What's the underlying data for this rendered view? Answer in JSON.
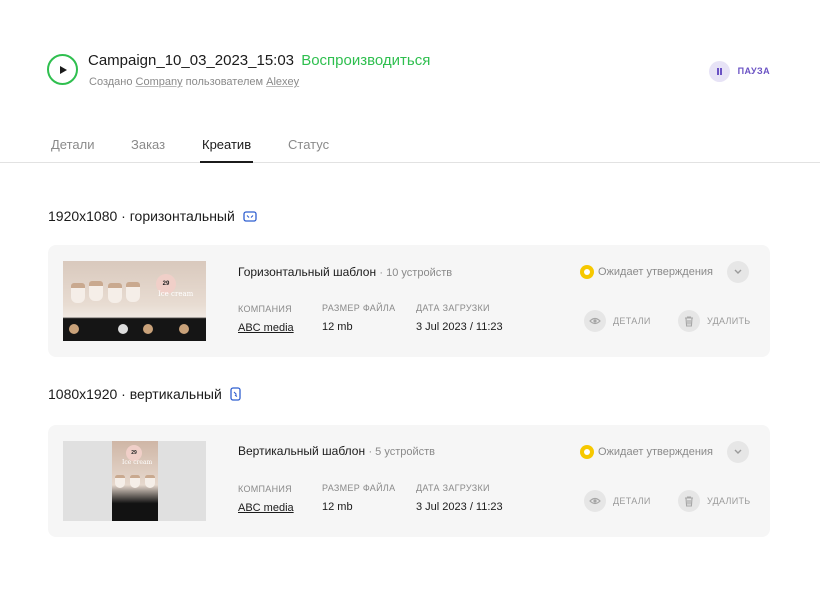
{
  "campaign": {
    "name": "Campaign_10_03_2023_15:03",
    "status": "Воспроизводиться",
    "created_prefix": "Создано",
    "company": "Company",
    "by_text": "пользователем",
    "user": "Alexey",
    "pause_label": "ПАУЗА"
  },
  "tabs": [
    {
      "label": "Детали",
      "active": false
    },
    {
      "label": "Заказ",
      "active": false
    },
    {
      "label": "Креатив",
      "active": true
    },
    {
      "label": "Статус",
      "active": false
    }
  ],
  "sections": [
    {
      "title": "1920x1080 · горизонтальный",
      "icon": "horizontal-screen-icon",
      "card": {
        "name": "Горизонтальный шаблон",
        "devices": "· 10 устройств",
        "status": "Ожидает утверждения",
        "company_label": "КОМПАНИЯ",
        "company_value": "ABC media",
        "size_label": "РАЗМЕР ФАЙЛА",
        "size_value": "12 mb",
        "date_label": "ДАТА ЗАГРУЗКИ",
        "date_value": "3 Jul 2023 / 11:23",
        "details_label": "ДЕТАЛИ",
        "delete_label": "УДАЛИТЬ",
        "thumb_badge": "29",
        "thumb_text": "Ice cream"
      }
    },
    {
      "title": "1080x1920 · вертикальный",
      "icon": "vertical-screen-icon",
      "card": {
        "name": "Вертикальный шаблон",
        "devices": "· 5 устройств",
        "status": "Ожидает утверждения",
        "company_label": "КОМПАНИЯ",
        "company_value": "ABC media",
        "size_label": "РАЗМЕР ФАЙЛА",
        "size_value": "12 mb",
        "date_label": "ДАТА ЗАГРУЗКИ",
        "date_value": "3 Jul 2023 / 11:23",
        "details_label": "ДЕТАЛИ",
        "delete_label": "УДАЛИТЬ",
        "thumb_badge": "29",
        "thumb_text": "Ice cream"
      }
    }
  ],
  "colors": {
    "accent_green": "#2fbf4f",
    "accent_purple": "#6a52c4",
    "pending_yellow": "#f6c800",
    "icon_blue": "#2f5fd0"
  }
}
